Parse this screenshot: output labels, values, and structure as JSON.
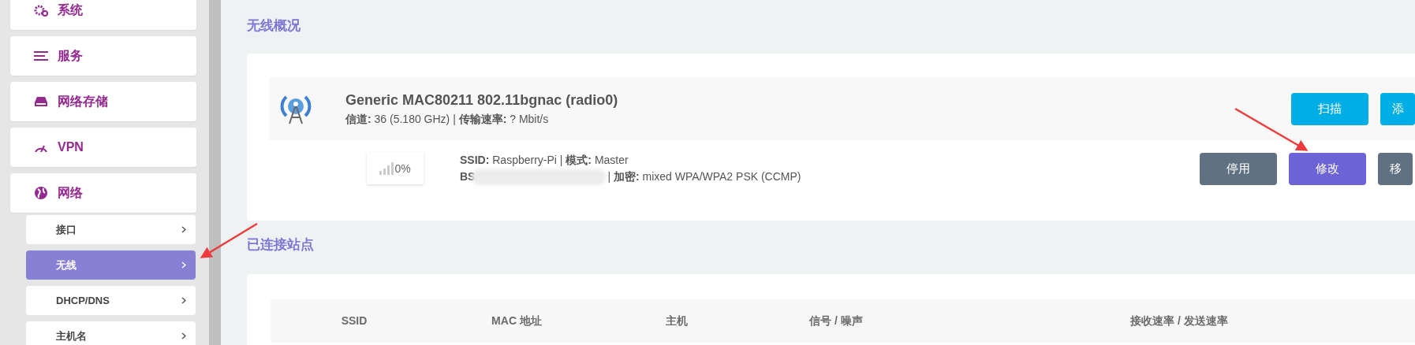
{
  "sidebar": {
    "menus": [
      {
        "label": "系统"
      },
      {
        "label": "服务"
      },
      {
        "label": "网络存储"
      },
      {
        "label": "VPN"
      },
      {
        "label": "网络"
      }
    ],
    "submenu": [
      {
        "label": "接口",
        "selected": false
      },
      {
        "label": "无线",
        "selected": true
      },
      {
        "label": "DHCP/DNS",
        "selected": false
      },
      {
        "label": "主机名",
        "selected": false
      }
    ]
  },
  "overview": {
    "heading": "无线概况",
    "radio": {
      "title": "Generic MAC80211 802.11bgnac (radio0)",
      "details": "**信道:** 36 (5.180 GHz) | **传输速率:** ? Mbit/s",
      "buttons": [
        {
          "label": "扫描",
          "kind": "primary"
        },
        {
          "label": "添",
          "kind": "primary"
        }
      ]
    },
    "network": {
      "signal": "0%",
      "line_1": "**SSID:** Raspberry-Pi | **模式:** Master",
      "bssid_prefix": "BS",
      "line_2": "| **加密:** mixed WPA/WPA2 PSK (CCMP)",
      "buttons": [
        {
          "label": "停用",
          "kind": "secondary"
        },
        {
          "label": "修改",
          "kind": "accent"
        },
        {
          "label": "移",
          "kind": "secondary"
        }
      ]
    }
  },
  "stations": {
    "heading": "已连接站点",
    "columns": [
      "SSID",
      "MAC 地址",
      "主机",
      "信号 / 噪声",
      "接收速率 / 发送速率"
    ]
  }
}
